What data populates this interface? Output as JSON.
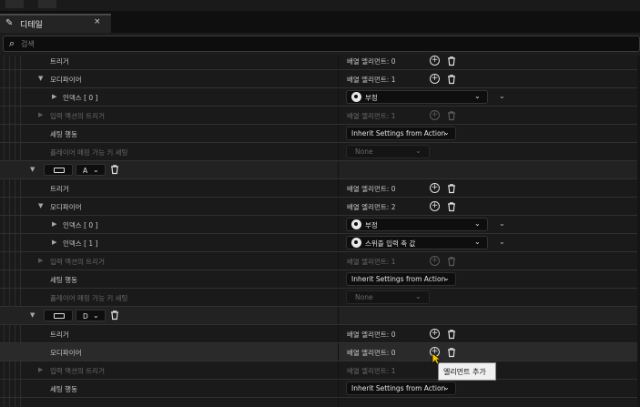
{
  "tab": {
    "title": "디테일",
    "close": "×"
  },
  "search": {
    "placeholder": "검색"
  },
  "labels": {
    "trigger": "트리거",
    "modifier": "모디파이어",
    "index0": "인덱스 [ 0 ]",
    "index1": "인덱스 [ 1 ]",
    "input_action_trigger": "입력 액션의 트리거",
    "setting_behavior": "세팅 행동",
    "player_mappable": "플레이어 매핑 가능 키 세팅"
  },
  "counts": {
    "zero": "배열 엘리먼트: 0",
    "one": "배열 엘리먼트: 1",
    "two": "배열 엘리먼트: 2"
  },
  "values": {
    "negate": "부정",
    "swizzle": "스위즐 입력 축 값",
    "inherit": "Inherit Settings from Action",
    "none": "None"
  },
  "keys": {
    "a": "A",
    "d": "D"
  },
  "tooltip": {
    "add_element": "엘리먼트 추가"
  },
  "colors": {
    "background": "#1a1a1a",
    "row_bar": "#222222",
    "highlight": "#2a2a2a",
    "tooltip_bg": "#f0f0f0",
    "cursor": "#f2c200"
  }
}
